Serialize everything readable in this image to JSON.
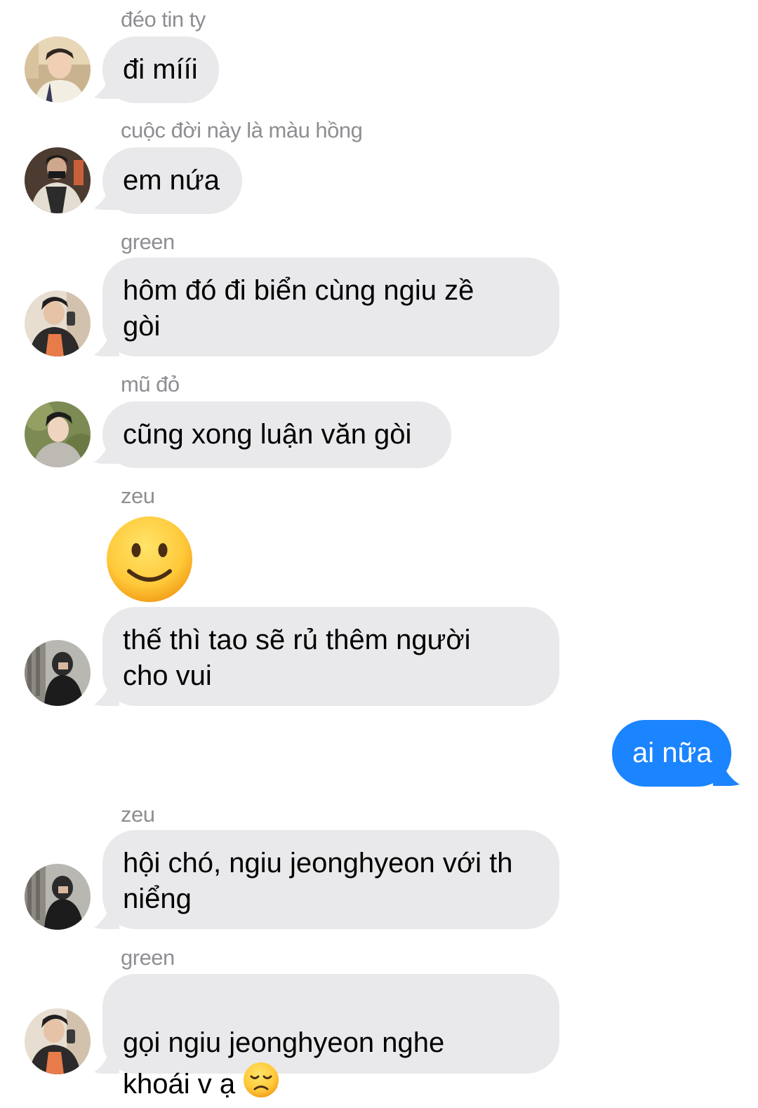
{
  "thread": {
    "messages": [
      {
        "sender": "đéo tin ty",
        "text": "đi mííi"
      },
      {
        "sender": "cuộc đời này là màu hồng",
        "text": "em nứa"
      },
      {
        "sender": "green",
        "text": "hôm đó đi biển cùng ngiu zề\ngòi"
      },
      {
        "sender": "mũ đỏ",
        "text": "cũng xong luận văn gòi"
      },
      {
        "sender": "zeu",
        "emoji": "slightly-smiling-face-emoji",
        "text": "thế thì tao sẽ rủ thêm người\ncho vui"
      },
      {
        "sender": "",
        "text": "ai nữa",
        "outgoing": true
      },
      {
        "sender": "zeu",
        "text": "hội chó, ngiu jeonghyeon với th\nniểng"
      },
      {
        "sender": "green",
        "text": "gọi ngiu jeonghyeon nghe\nkhoái v ạ",
        "emoji": "disappointed-face-emoji"
      }
    ]
  },
  "colors": {
    "incoming_bubble": "#e9e9eb",
    "outgoing_bubble": "#1b84ff",
    "sender_label": "#8e8e93"
  }
}
